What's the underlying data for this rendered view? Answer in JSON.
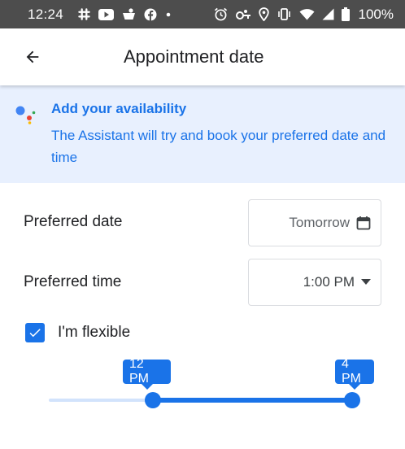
{
  "status_bar": {
    "time": "12:24",
    "battery_percent": "100%",
    "left_icons": [
      "slack-icon",
      "youtube-icon",
      "dessert-icon",
      "facebook-icon",
      "dot-icon"
    ],
    "right_icons": [
      "alarm-icon",
      "key-icon",
      "location-icon",
      "vibrate-icon",
      "wifi-icon",
      "signal-icon",
      "battery-icon"
    ]
  },
  "app_bar": {
    "title": "Appointment date",
    "back_icon": "arrow-back-icon"
  },
  "banner": {
    "title": "Add your availability",
    "body": "The Assistant will try and book your preferred date and time",
    "icon": "assistant-logo-icon"
  },
  "form": {
    "date_label": "Preferred date",
    "date_value": "Tomorrow",
    "date_icon": "calendar-icon",
    "time_label": "Preferred time",
    "time_value": "1:00 PM",
    "time_icon": "dropdown-arrow-icon"
  },
  "flexible": {
    "label": "I'm flexible",
    "checked": true
  },
  "range": {
    "start_label": "12 PM",
    "end_label": "4 PM"
  },
  "colors": {
    "accent": "#1a73e8",
    "banner_bg": "#e8f0fe",
    "status_bar_bg": "#4d4d4d"
  }
}
